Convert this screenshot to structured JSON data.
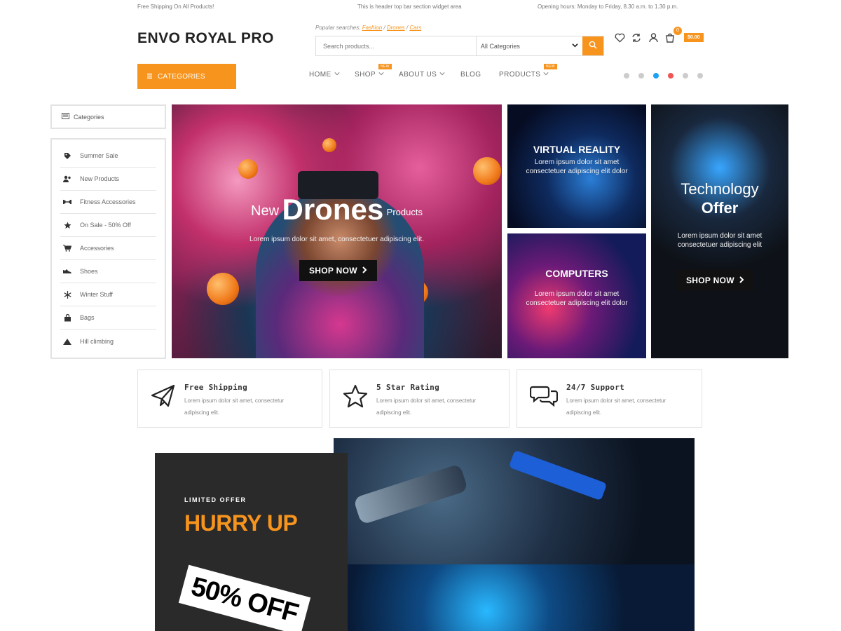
{
  "topbar": {
    "left": "Free Shipping On All Products!",
    "center": "This is header top bar section widget area",
    "right": "Opening hours: Monday to Friday, 8.30 a.m. to 1.30 p.m."
  },
  "header": {
    "logo": "ENVO ROYAL PRO",
    "popular_label": "Popular searches:",
    "popular_links": [
      "Fashion",
      "Drones",
      "Cars"
    ],
    "search_placeholder": "Search products...",
    "category_select": "All Categories",
    "cart_count": "0",
    "cart_total": "$0.00"
  },
  "nav": {
    "categories_button": "CATEGORIES",
    "items": [
      {
        "label": "HOME",
        "badge": ""
      },
      {
        "label": "SHOP",
        "badge": "NEW"
      },
      {
        "label": "ABOUT US",
        "badge": ""
      },
      {
        "label": "BLOG",
        "badge": ""
      },
      {
        "label": "PRODUCTS",
        "badge": "NEW"
      }
    ],
    "social_icons": [
      "dribbble-icon",
      "pinterest-icon",
      "twitter-icon",
      "youtube-icon",
      "instagram-icon",
      "linkedin-icon"
    ]
  },
  "sidebar": {
    "title": "Categories",
    "items": [
      {
        "label": "Summer Sale",
        "icon": "tag-icon"
      },
      {
        "label": "New Products",
        "icon": "users-icon"
      },
      {
        "label": "Fitness Accessories",
        "icon": "dumbbell-icon"
      },
      {
        "label": "On Sale - 50% Off",
        "icon": "star-icon"
      },
      {
        "label": "Accessories",
        "icon": "cart-icon"
      },
      {
        "label": "Shoes",
        "icon": "shoe-icon"
      },
      {
        "label": "Winter Stuff",
        "icon": "snowflake-icon"
      },
      {
        "label": "Bags",
        "icon": "bag-icon"
      },
      {
        "label": "Hill climbing",
        "icon": "mountain-icon"
      }
    ]
  },
  "hero": {
    "pre": "New",
    "title": "Drones",
    "post": "Products",
    "text": "Lorem ipsum dolor sit amet, consectetuer adipiscing elit.",
    "button": "SHOP NOW"
  },
  "promos": {
    "vr_title": "VIRTUAL REALITY",
    "vr_text": "Lorem ipsum dolor sit amet consectetuer adipiscing elit dolor",
    "comp_title": "COMPUTERS",
    "comp_text": "Lorem ipsum dolor sit amet consectetuer adipiscing elit dolor",
    "tech_title": "Technology",
    "tech_sub": "Offer",
    "tech_text": "Lorem ipsum dolor sit amet consectetuer adipiscing elit",
    "tech_button": "SHOP NOW"
  },
  "features": [
    {
      "title": "Free Shipping",
      "text": "Lorem ipsum dolor sit amet, consectetur adipiscing elit.",
      "icon": "paper-plane-icon"
    },
    {
      "title": "5 Star Rating",
      "text": "Lorem ipsum dolor sit amet, consectetur adipiscing elit.",
      "icon": "star-outline-icon"
    },
    {
      "title": "24/7 Support",
      "text": "Lorem ipsum dolor sit amet, consectetur adipiscing elit.",
      "icon": "chat-icon"
    }
  ],
  "offer": {
    "label": "LIMITED OFFER",
    "title": "HURRY UP",
    "badge": "50% OFF"
  },
  "colors": {
    "accent": "#f7941d",
    "dark": "#2a2a2a"
  }
}
